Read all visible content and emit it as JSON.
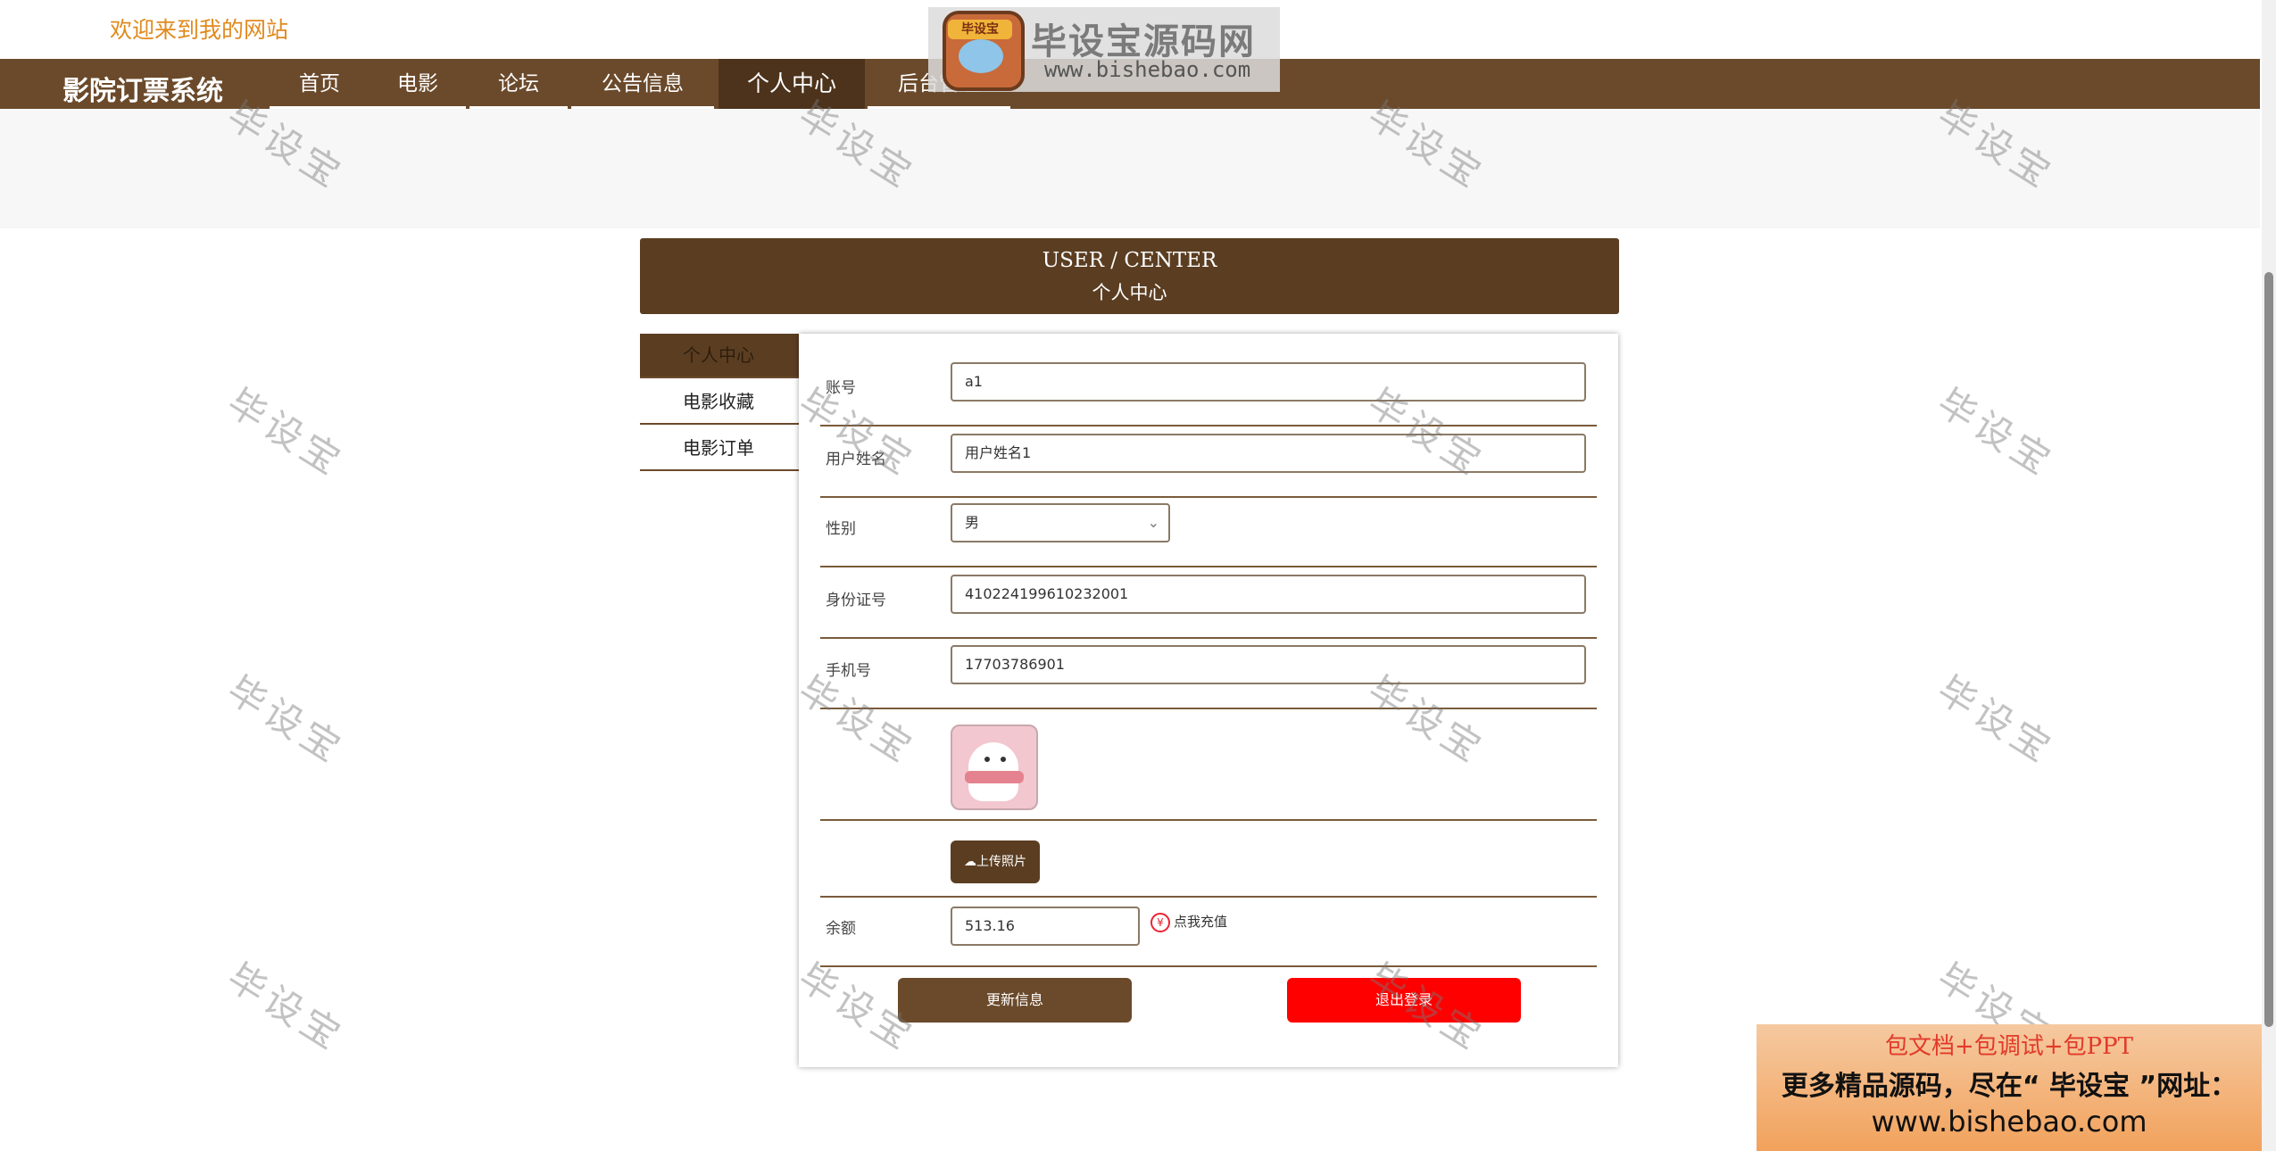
{
  "header": {
    "welcome": "欢迎来到我的网站",
    "site_title": "影院订票系统"
  },
  "brand": {
    "badge": "毕设宝",
    "title": "毕设宝源码网",
    "url": "www.bishebao.com"
  },
  "nav": {
    "items": [
      "首页",
      "电影",
      "论坛",
      "公告信息",
      "个人中心",
      "后台管理"
    ],
    "active": "个人中心"
  },
  "user_center": {
    "title_en": "USER / CENTER",
    "title_cn": "个人中心"
  },
  "sidebar": {
    "items": [
      "个人中心",
      "电影收藏",
      "电影订单"
    ]
  },
  "form": {
    "account_label": "账号",
    "account_value": "a1",
    "name_label": "用户姓名",
    "name_value": "用户姓名1",
    "gender_label": "性别",
    "gender_value": "男",
    "id_label": "身份证号",
    "id_value": "410224199610232001",
    "phone_label": "手机号",
    "phone_value": "17703786901",
    "upload_label": "上传照片",
    "balance_label": "余额",
    "balance_value": "513.16",
    "recharge_label": "点我充值",
    "update_button": "更新信息",
    "logout_button": "退出登录"
  },
  "watermark": "毕设宝",
  "ad": {
    "line1": "包文档+包调试+包PPT",
    "line2": "更多精品源码，尽在“ 毕设宝 ”网址：",
    "line3": "www.bishebao.com"
  },
  "colors": {
    "nav_bg": "#6b4a2b",
    "accent_dark": "#5b3e22",
    "logout": "#ff0000",
    "welcome": "#e08a1e"
  }
}
